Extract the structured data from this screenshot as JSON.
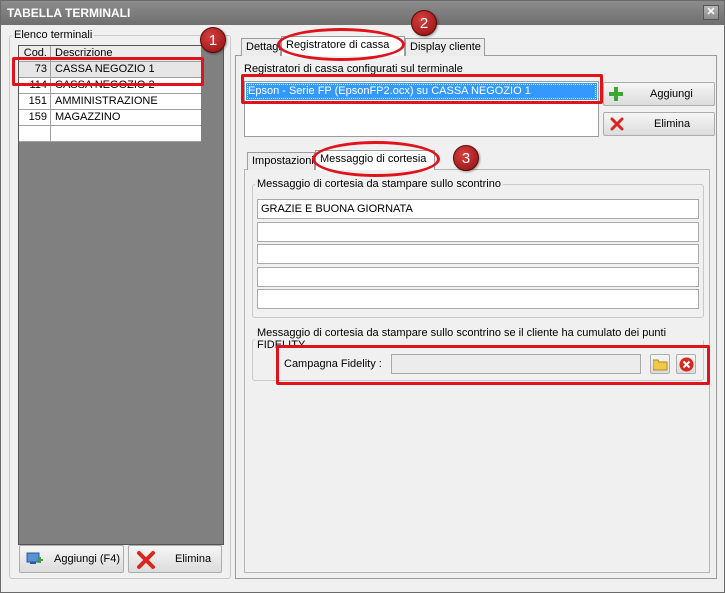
{
  "window": {
    "title": "TABELLA TERMINALI"
  },
  "terminals": {
    "group_label": "Elenco terminali",
    "columns": {
      "cod": "Cod.",
      "desc": "Descrizione"
    },
    "rows": [
      {
        "cod": "73",
        "desc": "CASSA NEGOZIO 1"
      },
      {
        "cod": "114",
        "desc": "CASSA NEGOZIO 2"
      },
      {
        "cod": "151",
        "desc": "AMMINISTRAZIONE"
      },
      {
        "cod": "159",
        "desc": "MAGAZZINO"
      }
    ],
    "add_label": "Aggiungi (F4)",
    "delete_label": "Elimina"
  },
  "tabs": [
    {
      "label": "Dettagli"
    },
    {
      "label": "Registratore di cassa"
    },
    {
      "label": "Display cliente"
    }
  ],
  "registers": {
    "label": "Registratori di cassa configurati sul terminale",
    "items": [
      "Epson - Serie FP (EpsonFP2.ocx) su CASSA NEGOZIO 1"
    ],
    "add_label": "Aggiungi",
    "delete_label": "Elimina"
  },
  "subtabs": [
    {
      "label": "Impostazioni"
    },
    {
      "label": "Messaggio di cortesia"
    }
  ],
  "courtesy": {
    "group_label": "Messaggio di cortesia da stampare sullo scontrino",
    "lines": [
      "GRAZIE E BUONA GIORNATA",
      "",
      "",
      "",
      ""
    ]
  },
  "fidelity": {
    "group_label": "Messaggio di cortesia da stampare sullo scontrino se il cliente ha cumulato dei punti FIDELITY",
    "campaign_label": "Campagna Fidelity :",
    "campaign_value": ""
  },
  "callouts": {
    "one": "1",
    "two": "2",
    "three": "3"
  },
  "colors": {
    "callout": "#e0121a",
    "selection": "#3399ff",
    "add_icon": "#3aa832",
    "delete_icon": "#d8281e"
  }
}
